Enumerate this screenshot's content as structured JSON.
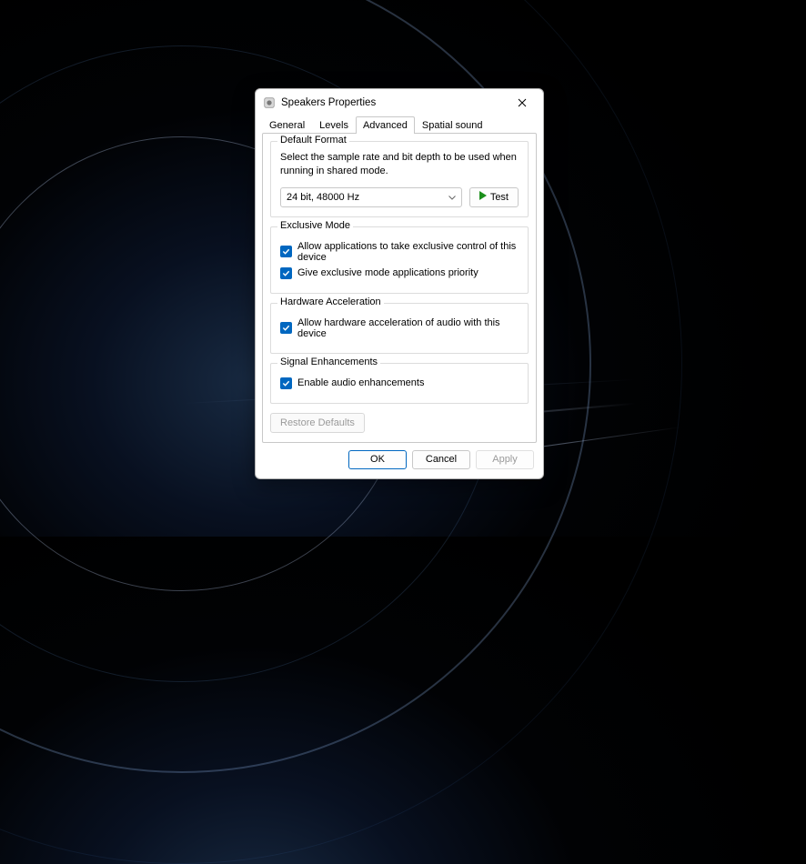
{
  "titlebar": {
    "title": "Speakers Properties"
  },
  "tabs": {
    "general": "General",
    "levels": "Levels",
    "advanced": "Advanced",
    "spatial": "Spatial sound"
  },
  "default_format": {
    "legend": "Default Format",
    "desc": "Select the sample rate and bit depth to be used when running in shared mode.",
    "selected": "24 bit, 48000 Hz",
    "test_label": "Test"
  },
  "exclusive": {
    "legend": "Exclusive Mode",
    "opt1": "Allow applications to take exclusive control of this device",
    "opt2": "Give exclusive mode applications priority"
  },
  "hardware": {
    "legend": "Hardware Acceleration",
    "opt1": "Allow hardware acceleration of audio with this device"
  },
  "signal": {
    "legend": "Signal Enhancements",
    "opt1": "Enable audio enhancements"
  },
  "restore": "Restore Defaults",
  "footer": {
    "ok": "OK",
    "cancel": "Cancel",
    "apply": "Apply"
  }
}
